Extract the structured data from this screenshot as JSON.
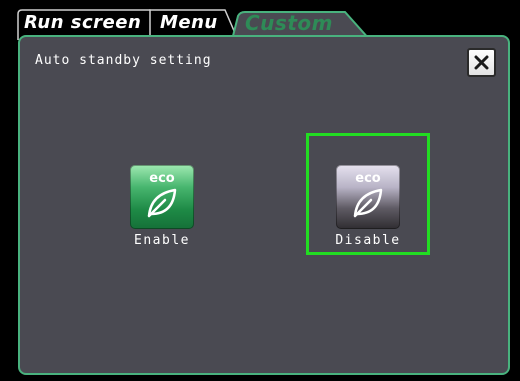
{
  "tabs": [
    {
      "label": "Run screen",
      "active": false
    },
    {
      "label": "Menu",
      "active": false
    },
    {
      "label": "Custom",
      "active": true
    }
  ],
  "dialog": {
    "title": "Auto standby setting",
    "close_label": "X"
  },
  "options": [
    {
      "label": "Enable",
      "icon_text": "eco",
      "icon": "eco-leaf-icon",
      "selected": false
    },
    {
      "label": "Disable",
      "icon_text": "eco",
      "icon": "eco-leaf-icon",
      "selected": true
    }
  ],
  "colors": {
    "accent_green": "#49b27e",
    "selected_border": "#22dd22",
    "panel_bg": "#4a4a52",
    "inactive_tab": "#ffffff",
    "active_tab": "#2e8b57"
  }
}
